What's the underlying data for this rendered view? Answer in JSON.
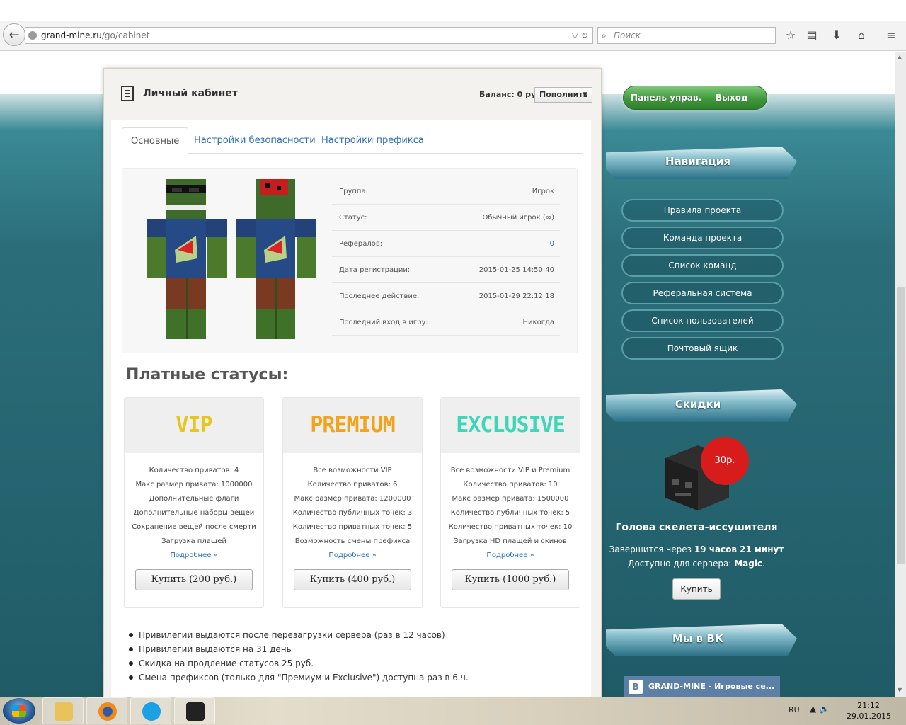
{
  "browser": {
    "url_host": "grand-mine.ru",
    "url_path": "/go/cabinet",
    "search_placeholder": "Поиск"
  },
  "header": {
    "title": "Личный кабинет",
    "balance": "Баланс: 0 руб.",
    "topup_label": "Пополнить"
  },
  "tabs": [
    {
      "label": "Основные"
    },
    {
      "label": "Настройки безопасности"
    },
    {
      "label": "Настройки префикса"
    }
  ],
  "profile": {
    "rows": [
      {
        "key": "Группа:",
        "value": "Игрок"
      },
      {
        "key": "Статус:",
        "value": "Обычный игрок (∞)"
      },
      {
        "key": "Рефералов:",
        "value": "0"
      },
      {
        "key": "Дата регистрации:",
        "value": "2015-01-25 14:50:40"
      },
      {
        "key": "Последнее действие:",
        "value": "2015-01-29 22:12:18"
      },
      {
        "key": "Последний вход в игру:",
        "value": "Никогда"
      }
    ]
  },
  "paid": {
    "title": "Платные статусы:",
    "more_label": "Подробнее »",
    "cards": [
      {
        "name": "VIP",
        "color": "#e8c51a",
        "features": [
          "Количество приватов: 4",
          "Макс размер привата: 1000000",
          "Дополнительные флаги",
          "Дополнительные наборы вещей",
          "Сохранение вещей после смерти",
          "Загрузка плащей"
        ],
        "buy": "Купить (200 руб.)"
      },
      {
        "name": "PREMIUM",
        "color": "#f0a41e",
        "features": [
          "Все возможности VIP",
          "Количество приватов: 6",
          "Макс размер привата: 1200000",
          "Количество публичных точек: 3",
          "Количество приватных точек: 5",
          "Возможность смены префикса"
        ],
        "buy": "Купить (400 руб.)"
      },
      {
        "name": "EXCLUSIVE",
        "color": "#3fd6b8",
        "features": [
          "Все возможности VIP и Premium",
          "Количество приватов: 10",
          "Макс размер привата: 1500000",
          "Количество публичных точек: 5",
          "Количество приватных точек: 10",
          "Загрузка HD плащей и скинов"
        ],
        "buy": "Купить (1000 руб.)"
      }
    ],
    "notes": [
      "Привилегии выдаются после перезагрузки сервера (раз в 12 часов)",
      "Привилегии выдаются на 31 день",
      "Скидка на продление статусов 25 руб.",
      "Смена префиксов (только для \"Премиум и Exclusive\") доступна раз в 6 ч."
    ]
  },
  "user_panel": {
    "panel_label": "Панель управ.",
    "logout_label": "Выход"
  },
  "navigation": {
    "title": "Навигация",
    "items": [
      "Правила проекта",
      "Команда проекта",
      "Список команд",
      "Реферальная система",
      "Список пользователей",
      "Почтовый ящик"
    ]
  },
  "discounts": {
    "title": "Скидки",
    "price": "30р.",
    "item_name": "Голова скелета-иссушителя",
    "time_prefix": "Завершится через ",
    "time_value": "19 часов 21 минут",
    "server_prefix": "Доступно для сервера: ",
    "server_value": "Magic",
    "server_suffix": ".",
    "buy_label": "Купить"
  },
  "vk": {
    "title": "Мы в ВК",
    "group": "GRAND-MINE - Игровые се..."
  },
  "taskbar": {
    "lang": "RU",
    "time": "21:12",
    "date": "29.01.2015"
  }
}
